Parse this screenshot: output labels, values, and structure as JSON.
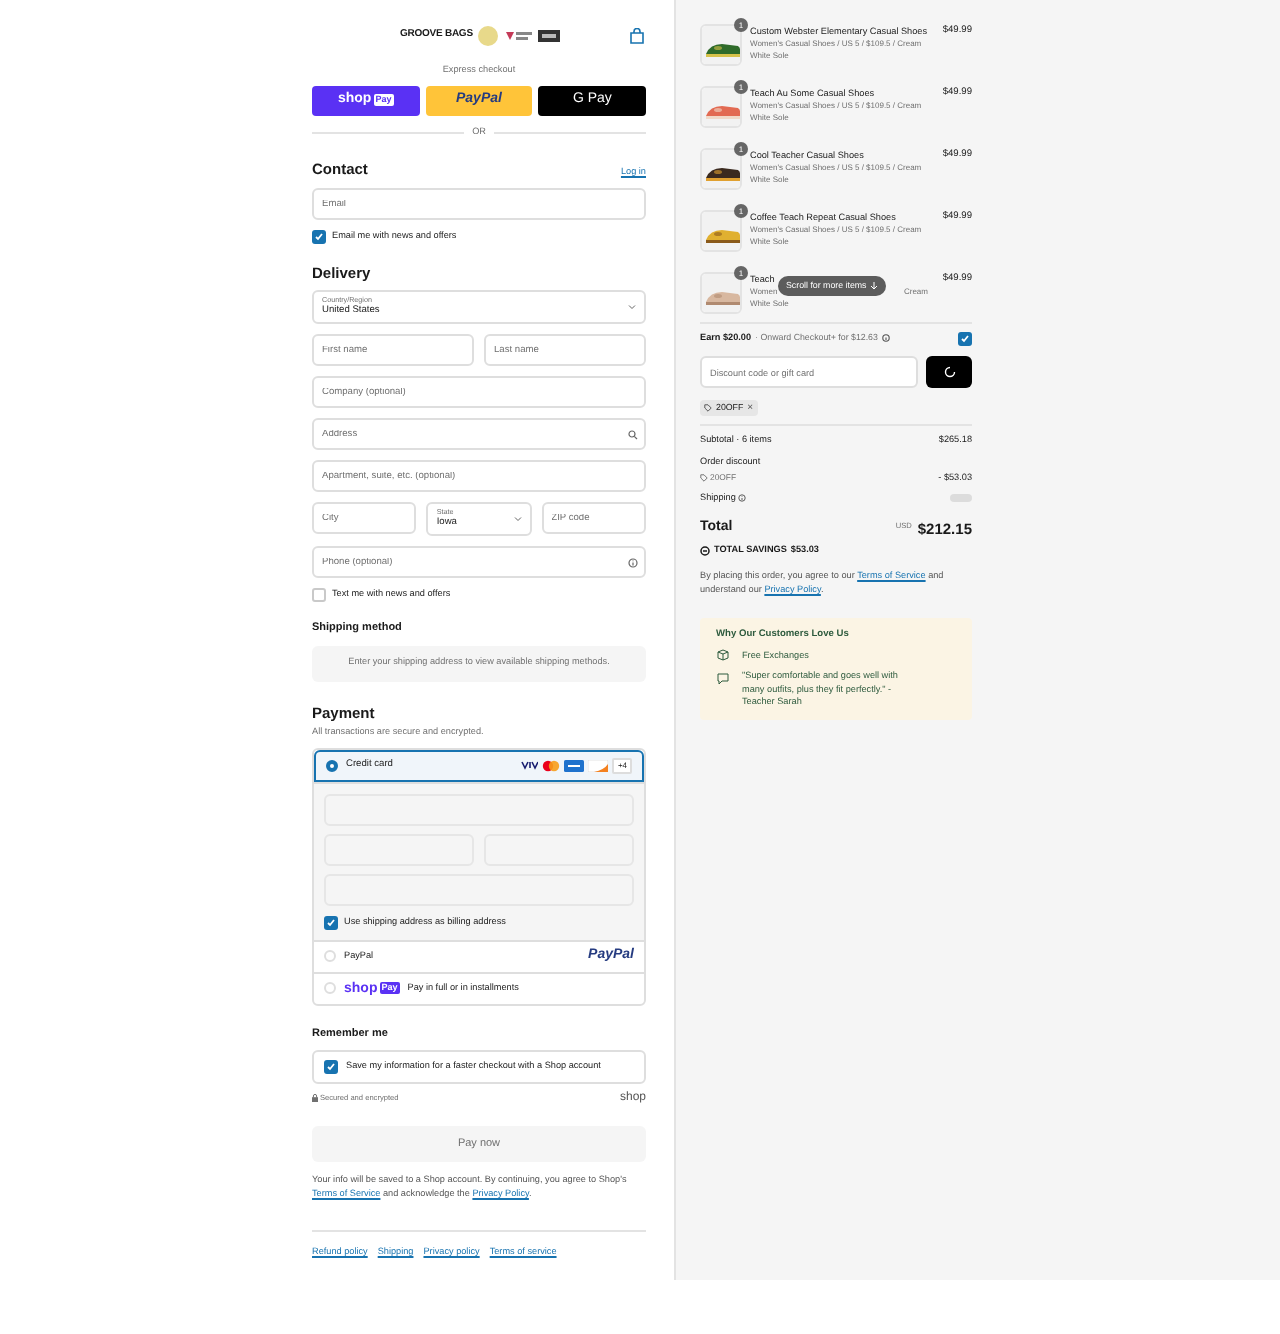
{
  "header": {
    "logo": "GROOVE BAGS"
  },
  "express_checkout": {
    "label": "Express checkout",
    "buttons": [
      {
        "kind": "shop",
        "label": "shop",
        "badge": "Pay"
      },
      {
        "kind": "paypal",
        "label": "PayPal"
      },
      {
        "kind": "gpay",
        "label": "G Pay"
      }
    ],
    "divider": "OR"
  },
  "contact": {
    "title": "Contact",
    "link": "Log in",
    "email_placeholder": "Email",
    "newsletter": {
      "label": "Email me with news and offers",
      "checked": true
    }
  },
  "delivery": {
    "title": "Delivery",
    "rows": [
      [
        {
          "kind": "select",
          "label": "Country/Region",
          "value": "United States"
        }
      ],
      [
        {
          "kind": "text",
          "placeholder": "First name"
        },
        {
          "kind": "text",
          "placeholder": "Last name"
        }
      ],
      [
        {
          "kind": "text",
          "placeholder": "Company (optional)"
        }
      ],
      [
        {
          "kind": "search",
          "placeholder": "Address"
        }
      ],
      [
        {
          "kind": "text",
          "placeholder": "Apartment, suite, etc. (optional)"
        }
      ],
      [
        {
          "kind": "text",
          "placeholder": "City"
        },
        {
          "kind": "select",
          "label": "State",
          "value": "Iowa"
        },
        {
          "kind": "text",
          "placeholder": "ZIP code"
        }
      ],
      [
        {
          "kind": "help",
          "placeholder": "Phone (optional)"
        }
      ]
    ],
    "sms": {
      "label": "Text me with news and offers",
      "checked": false
    }
  },
  "shipping_method": {
    "title": "Shipping method",
    "message": "Enter your shipping address to view available shipping methods."
  },
  "payment": {
    "title": "Payment",
    "subtitle": "All transactions are secure and encrypted.",
    "methods": [
      {
        "kind": "card",
        "label": "Credit card",
        "selected": true,
        "more": "+4"
      },
      {
        "kind": "paypal",
        "label": "PayPal",
        "selected": false,
        "logo": "PayPal"
      },
      {
        "kind": "shoppay",
        "label": "Pay in full or in installments",
        "selected": false,
        "logo": "shop",
        "badge": "Pay"
      }
    ],
    "billing": {
      "label": "Use shipping address as billing address",
      "checked": true
    }
  },
  "remember": {
    "title": "Remember me",
    "label": "Save my information for a faster checkout with a Shop account",
    "checked": true,
    "secure": "Secured and encrypted",
    "brand": "shop"
  },
  "pay_button": "Pay now",
  "legal": {
    "before": "Your info will be saved to a Shop account. By continuing, you agree to Shop's ",
    "link1": "Terms of Service",
    "middle": " and acknowledge the ",
    "link2": "Privacy Policy",
    "after": "."
  },
  "footer_links": [
    "Refund policy",
    "Shipping",
    "Privacy policy",
    "Terms of service"
  ],
  "order": {
    "items": [
      {
        "title": "Custom Webster Elementary Casual Shoes",
        "variant_lines": [
          [
            "Women's Casual Shoes / US 5 / $109.5 / Cream"
          ],
          [
            "White Sole"
          ]
        ],
        "price": "$49.99",
        "quantity": "1"
      },
      {
        "title": "Teach Au Some Casual Shoes",
        "variant_lines": [
          [
            "Women's Casual Shoes / US 5 / $109.5 / Cream"
          ],
          [
            "White Sole"
          ]
        ],
        "price": "$49.99",
        "quantity": "1"
      },
      {
        "title": "Cool Teacher Casual Shoes",
        "variant_lines": [
          [
            "Women's Casual Shoes / US 5 / $109.5 / Cream"
          ],
          [
            "White Sole"
          ]
        ],
        "price": "$49.99",
        "quantity": "1"
      },
      {
        "title": "Coffee Teach Repeat Casual Shoes",
        "variant_lines": [
          [
            "Women's Casual Shoes / US 5 / $109.5 / Cream"
          ],
          [
            "White Sole"
          ]
        ],
        "price": "$49.99",
        "quantity": "1"
      },
      {
        "title": "Teach",
        "variant_lines": [
          [
            "Women",
            "Cream"
          ],
          [
            "White Sole"
          ]
        ],
        "price": "$49.99",
        "quantity": "1"
      }
    ],
    "scroll_hint": "Scroll for more items"
  },
  "rewards": {
    "earn": "Earn $20.00",
    "detail": "· Onward Checkout+ for $12.63",
    "checked": true
  },
  "discount": {
    "placeholder": "Discount code or gift card",
    "tag": "20OFF",
    "remove": "×"
  },
  "summary": {
    "subtotal_label": "Subtotal · 6 items",
    "subtotal": "$265.18",
    "discount_label": "Order discount",
    "code": "20OFF",
    "discount": "- $53.03",
    "shipping_label": "Shipping"
  },
  "total": {
    "label": "Total",
    "currency": "USD",
    "amount": "$212.15",
    "savings_label": "TOTAL SAVINGS",
    "savings": "$53.03"
  },
  "agreement": {
    "before": "By placing this order, you agree to our ",
    "link1": "Terms of Service",
    "middle": " and understand our ",
    "link2": "Privacy Policy",
    "after": "."
  },
  "testimonials": {
    "title": "Why Our Customers Love Us",
    "items": [
      {
        "kind": "exchange",
        "text": "Free Exchanges"
      },
      {
        "kind": "quote",
        "text": "\"Super comfortable and goes well with many outfits, plus they fit perfectly.\" - Teacher Sarah"
      }
    ]
  }
}
